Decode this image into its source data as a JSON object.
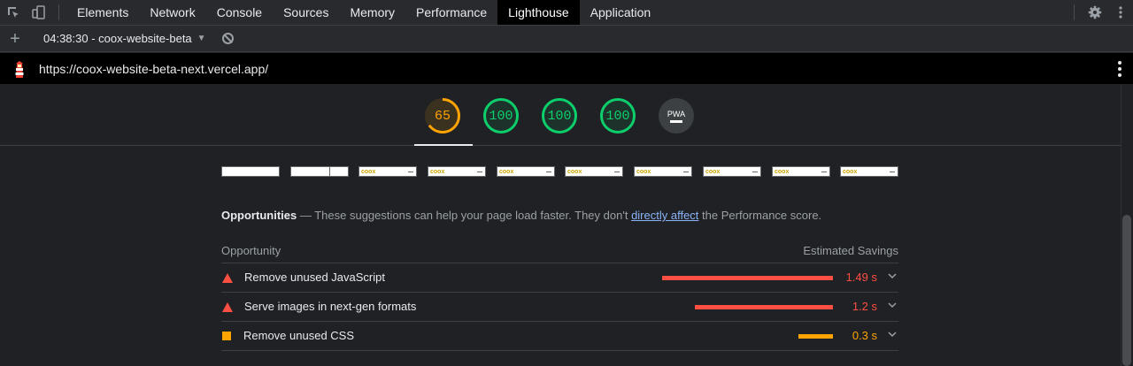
{
  "devtools": {
    "tabs": [
      "Elements",
      "Network",
      "Console",
      "Sources",
      "Memory",
      "Performance",
      "Lighthouse",
      "Application"
    ],
    "active_tab": "Lighthouse"
  },
  "lighthouse": {
    "report_select": "04:38:30 - coox-website-beta",
    "url": "https://coox-website-beta-next.vercel.app/",
    "scores": [
      {
        "value": "65",
        "status": "average",
        "color": "#ffa400",
        "fraction": 0.65
      },
      {
        "value": "100",
        "status": "pass",
        "color": "#0cce6b",
        "fraction": 1.0
      },
      {
        "value": "100",
        "status": "pass",
        "color": "#0cce6b",
        "fraction": 1.0
      },
      {
        "value": "100",
        "status": "pass",
        "color": "#0cce6b",
        "fraction": 1.0
      }
    ],
    "pwa": {
      "label": "PWA"
    },
    "filmstrip_logo": "coox"
  },
  "opportunities": {
    "title": "Opportunities",
    "dash": "—",
    "desc_before": "These suggestions can help your page load faster. They don't",
    "link": "directly affect",
    "desc_after": "the Performance score.",
    "col_left": "Opportunity",
    "col_right": "Estimated Savings",
    "items": [
      {
        "label": "Remove unused JavaScript",
        "value": "1.49 s",
        "severity": "fail",
        "color": "#ff4e42"
      },
      {
        "label": "Serve images in next-gen formats",
        "value": "1.2 s",
        "severity": "fail",
        "color": "#ff4e42"
      },
      {
        "label": "Remove unused CSS",
        "value": "0.3 s",
        "severity": "average",
        "color": "#ffa400"
      }
    ]
  }
}
